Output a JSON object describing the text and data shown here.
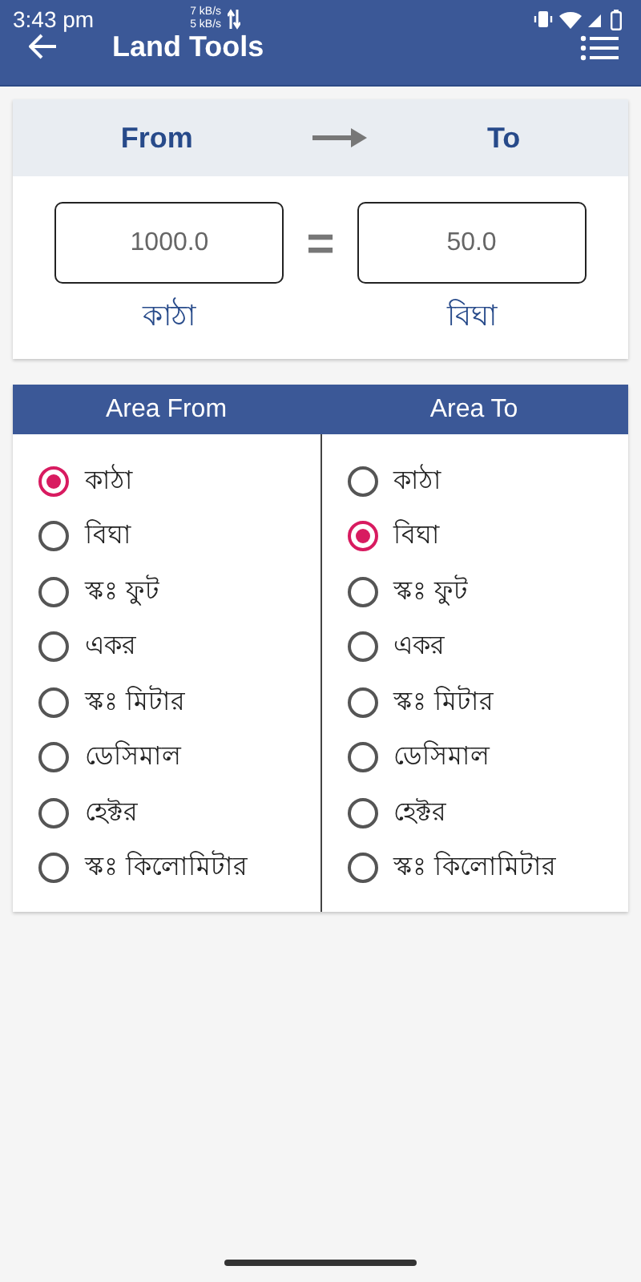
{
  "status_bar": {
    "time": "3:43 pm",
    "upload_speed": "7 kB/s",
    "download_speed": "5 kB/s"
  },
  "app_bar": {
    "title": "Land Tools"
  },
  "converter": {
    "from_label": "From",
    "to_label": "To",
    "from_value": "1000.0",
    "equals": "=",
    "to_value": "50.0",
    "from_unit": "কাঠা",
    "to_unit": "বিঘা"
  },
  "units_table": {
    "columns": [
      {
        "title": "Area From",
        "options": [
          {
            "label": "কাঠা",
            "selected": true
          },
          {
            "label": "বিঘা",
            "selected": false
          },
          {
            "label": "স্কঃ ফুট",
            "selected": false
          },
          {
            "label": "একর",
            "selected": false
          },
          {
            "label": "স্কঃ মিটার",
            "selected": false
          },
          {
            "label": "ডেসিমাল",
            "selected": false
          },
          {
            "label": "হেক্টর",
            "selected": false
          },
          {
            "label": "স্কঃ কিলোমিটার",
            "selected": false
          }
        ]
      },
      {
        "title": "Area To",
        "options": [
          {
            "label": "কাঠা",
            "selected": false
          },
          {
            "label": "বিঘা",
            "selected": true
          },
          {
            "label": "স্কঃ ফুট",
            "selected": false
          },
          {
            "label": "একর",
            "selected": false
          },
          {
            "label": "স্কঃ মিটার",
            "selected": false
          },
          {
            "label": "ডেসিমাল",
            "selected": false
          },
          {
            "label": "হেক্টর",
            "selected": false
          },
          {
            "label": "স্কঃ কিলোমিটার",
            "selected": false
          }
        ]
      }
    ]
  }
}
